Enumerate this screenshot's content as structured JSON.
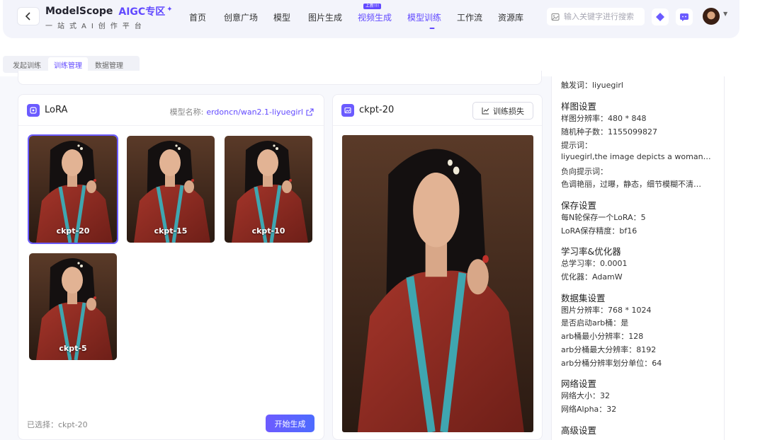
{
  "header": {
    "brand_name": "ModelScope",
    "brand_aigc": "AIGC专区",
    "brand_slogan": "一站式AI创作平台",
    "nav": [
      "首页",
      "创意广场",
      "模型",
      "图片生成",
      "视频生成",
      "模型训练",
      "工作流",
      "资源库"
    ],
    "nav_badge": "上新!!!",
    "search_placeholder": "输入关键字进行搜索"
  },
  "subtabs": [
    "发起训练",
    "训练管理",
    "数据管理"
  ],
  "lora_card": {
    "title": "LoRA",
    "model_name_label": "模型名称:",
    "model_name_value": "erdoncn/wan2.1-liyuegirl",
    "thumbs": [
      "ckpt-20",
      "ckpt-15",
      "ckpt-10",
      "ckpt-5"
    ],
    "selected_text": "已选择：ckpt-20",
    "start_button": "开始生成"
  },
  "ckpt_card": {
    "title": "ckpt-20",
    "loss_button": "训练损失"
  },
  "right_panel": {
    "trigger": "触发词：liyuegirl",
    "sample_title": "样图设置",
    "sample_resolution": "样图分辨率：480 * 848",
    "seed": "随机种子数：1155099827",
    "prompt_label": "提示词：",
    "prompt_value": "liyuegirl,the image depicts a woman ge…",
    "neg_label": "负向提示词：",
    "neg_value": "色调艳丽，过曝，静态，细节模糊不清…",
    "save_title": "保存设置",
    "save_every": "每N轮保存一个LoRA：5",
    "save_precision": "LoRA保存精度：bf16",
    "lr_title": "学习率&优化器",
    "lr": "总学习率：0.0001",
    "optimizer": "优化器：AdamW",
    "dataset_title": "数据集设置",
    "img_res": "图片分辨率：768 * 1024",
    "arb_enable": "是否启动arb桶：是",
    "arb_min": "arb桶最小分辨率：128",
    "arb_max": "arb分桶最大分辨率：8192",
    "arb_unit": "arb分桶分辨率划分单位：64",
    "network_title": "网络设置",
    "net_dim": "网络大小：32",
    "net_alpha": "网络Alpha：32",
    "advanced_title": "高级设置"
  },
  "colors": {
    "accent": "#624aff",
    "dress": "#8e2a22",
    "trim": "#3fa6b0"
  }
}
